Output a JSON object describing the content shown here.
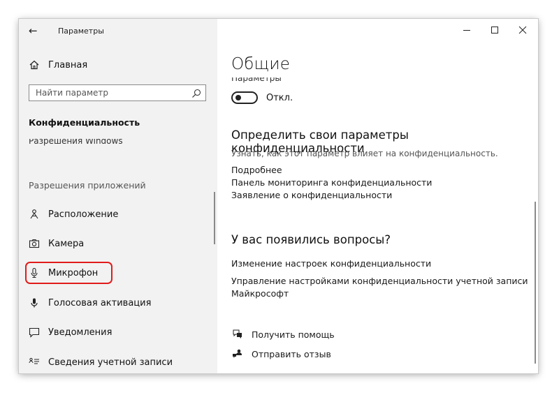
{
  "window": {
    "title": "Параметры",
    "back_glyph": "←",
    "controls": [
      "minimize-icon",
      "maximize-icon",
      "close-icon"
    ]
  },
  "sidebar": {
    "home": {
      "label": "Главная",
      "icon": "home-icon"
    },
    "search": {
      "placeholder": "Найти параметр",
      "icon": "search-icon"
    },
    "section_title": "Конфиденциальность",
    "partial_item": "Разрешения Windows",
    "group_label": "Разрешения приложений",
    "items": [
      {
        "label": "Расположение",
        "icon": "location-icon"
      },
      {
        "label": "Камера",
        "icon": "camera-icon"
      },
      {
        "label": "Микрофон",
        "icon": "microphone-icon",
        "highlighted": true
      },
      {
        "label": "Голосовая активация",
        "icon": "voice-activation-icon"
      },
      {
        "label": "Уведомления",
        "icon": "notifications-icon"
      },
      {
        "label": "Сведения учетной записи",
        "icon": "account-info-icon"
      }
    ],
    "highlight_color": "#e21b1b"
  },
  "main": {
    "title": "Общие",
    "partial_label": "Параметры",
    "toggle": {
      "state_label": "Откл.",
      "on": false
    },
    "privacy_section": {
      "heading": "Определить свои параметры конфиденциальности",
      "subtitle": "Узнать, как этот параметр влияет на конфиденциальность.",
      "links": [
        "Подробнее",
        "Панель мониторинга конфиденциальности",
        "Заявление о конфиденциальности"
      ]
    },
    "questions_section": {
      "heading": "У вас появились вопросы?",
      "links": [
        "Изменение настроек конфиденциальности",
        "Управление настройками конфиденциальности учетной записи",
        "Майкрософт"
      ]
    },
    "footer": {
      "help": {
        "label": "Получить помощь",
        "icon": "help-icon"
      },
      "feedback": {
        "label": "Отправить отзыв",
        "icon": "feedback-icon"
      }
    }
  }
}
